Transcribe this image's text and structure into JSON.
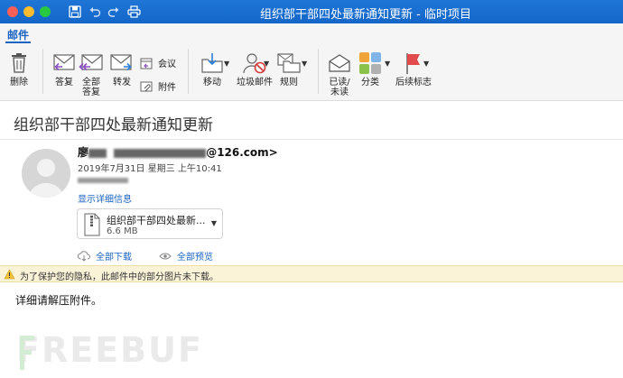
{
  "window": {
    "title": "组织部干部四处最新通知更新 - 临时项目",
    "traffic_colors": [
      "#ff5f57",
      "#febc2e",
      "#28c840"
    ]
  },
  "tabs": {
    "mail": "邮件"
  },
  "ribbon": {
    "delete": "删除",
    "reply": "答复",
    "reply_all_1": "全部",
    "reply_all_2": "答复",
    "forward": "转发",
    "meeting": "会议",
    "attachment": "附件",
    "move": "移动",
    "junk": "垃圾邮件",
    "rules": "规则",
    "read_1": "已读/",
    "read_2": "未读",
    "categorize": "分类",
    "followup": "后续标志"
  },
  "message": {
    "subject": "组织部干部四处最新通知更新",
    "sender_name": "廖",
    "sender_email_tail": "@126.com>",
    "date": "2019年7月31日 星期三 上午10:41",
    "show_details": "显示详细信息",
    "attachment": {
      "name": "组织部干部四处最新...",
      "size": "6.6 MB"
    },
    "download_all": "全部下载",
    "preview_all": "全部预览",
    "privacy_notice": "为了保护您的隐私，此邮件中的部分图片未下载。",
    "body": "详细请解压附件。"
  },
  "watermark": "FREEBUF"
}
